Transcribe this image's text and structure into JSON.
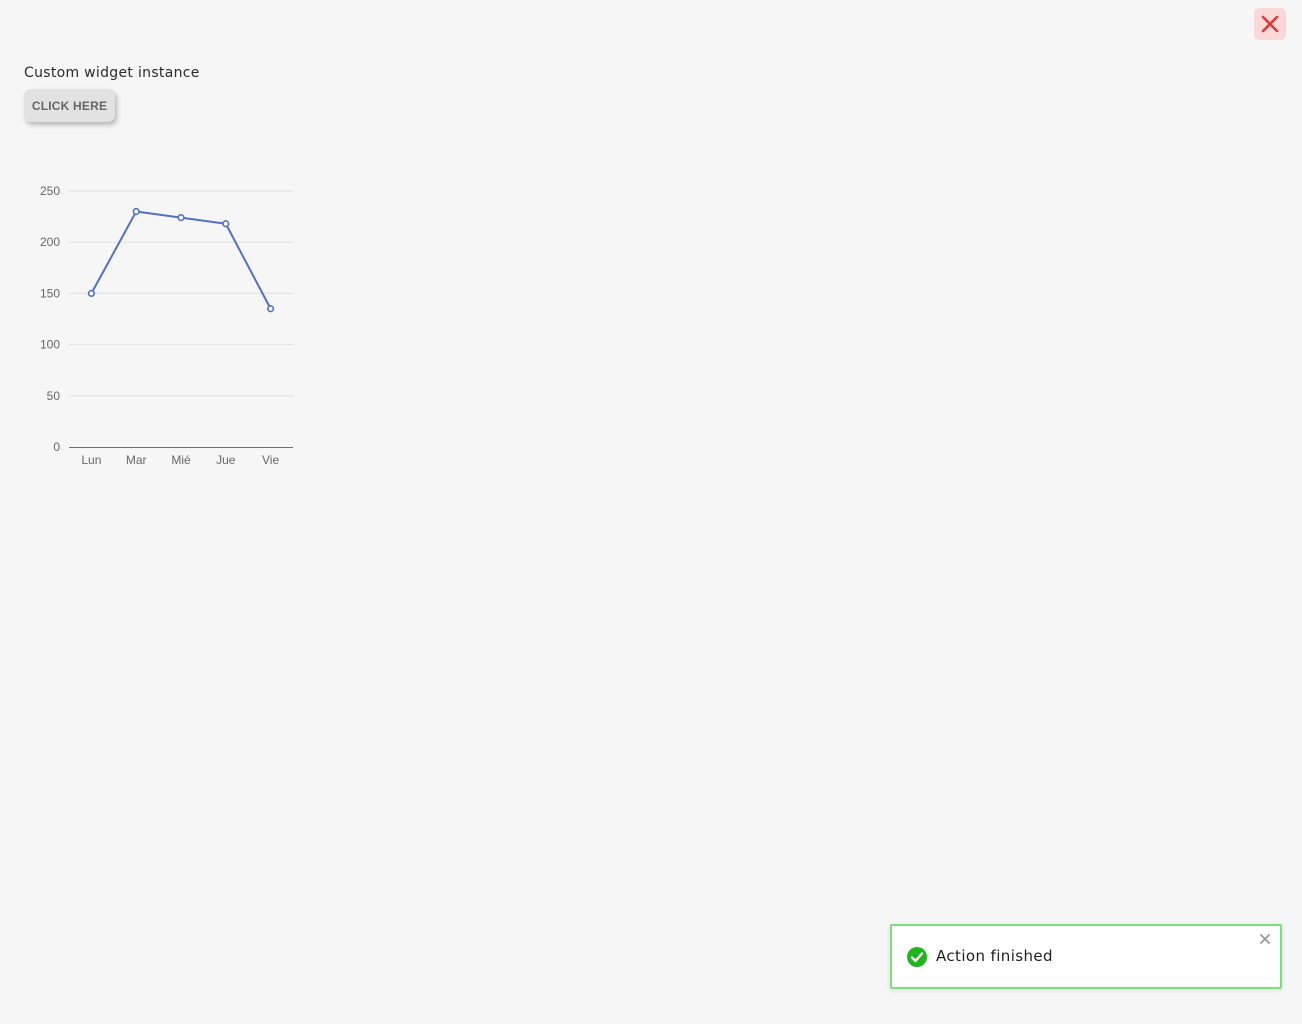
{
  "close_button": {
    "icon": "close-icon",
    "color": "#e03a3a",
    "background": "#fbd7d7"
  },
  "widget": {
    "title": "Custom widget instance",
    "button_label": "CLICK HERE"
  },
  "chart_data": {
    "type": "line",
    "categories": [
      "Lun",
      "Mar",
      "Mié",
      "Jue",
      "Vie"
    ],
    "series": [
      {
        "values": [
          150,
          230,
          224,
          218,
          135
        ],
        "color": "#5470c6"
      }
    ],
    "ylim": [
      0,
      250
    ],
    "yticks": [
      "0",
      "50",
      "100",
      "150",
      "200",
      "250"
    ],
    "grid": true
  },
  "toast": {
    "icon": "check-circle-icon",
    "message": "Action finished",
    "close_icon": "close-icon",
    "accent": "#1fb51f"
  }
}
